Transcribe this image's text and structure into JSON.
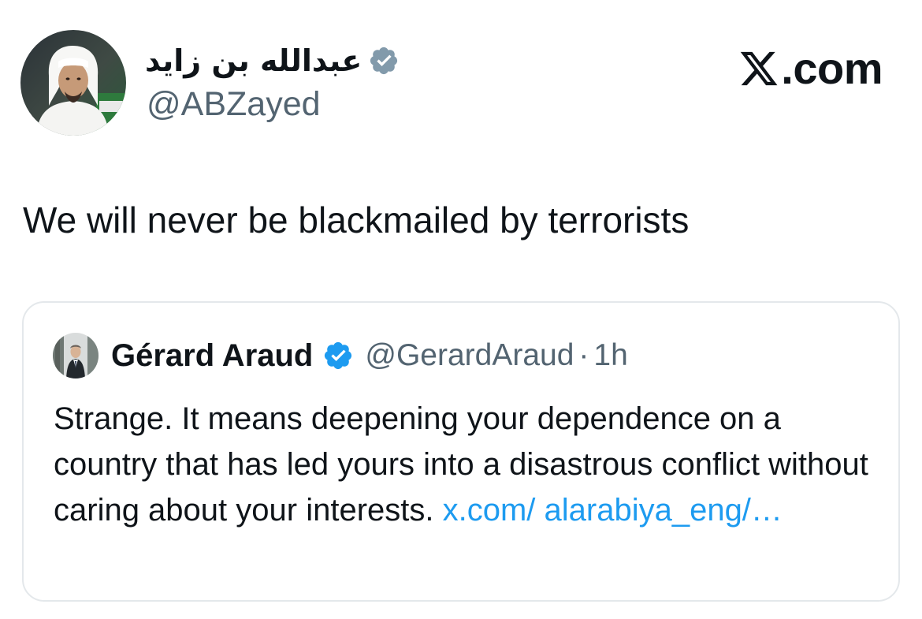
{
  "author": {
    "display_name": "عبدالله بن زايد",
    "handle": "@ABZayed",
    "verified_badge": "verified-grey-icon",
    "avatar": "profile-photo-man-white-headdress"
  },
  "brand": {
    "logo": "x-logo-icon",
    "text": ".com"
  },
  "tweet": {
    "text": "We will never be blackmailed by terrorists"
  },
  "quoted_tweet": {
    "author_name": "Gérard Araud",
    "verified_badge": "verified-blue-icon",
    "handle": "@GerardAraud",
    "separator": "·",
    "time": "1h",
    "text": "Strange. It means deepening your dependence on a country that has led yours into a disastrous conflict without caring about your interests. ",
    "link": "x.com/ alarabiya_eng/…",
    "avatar": "profile-photo-man-suit"
  },
  "colors": {
    "text_primary": "#0f1419",
    "text_secondary": "#536471",
    "link": "#1d9bf0",
    "verified_blue": "#1d9bf0",
    "verified_grey": "#829aab",
    "card_border": "#e4e8eb"
  }
}
